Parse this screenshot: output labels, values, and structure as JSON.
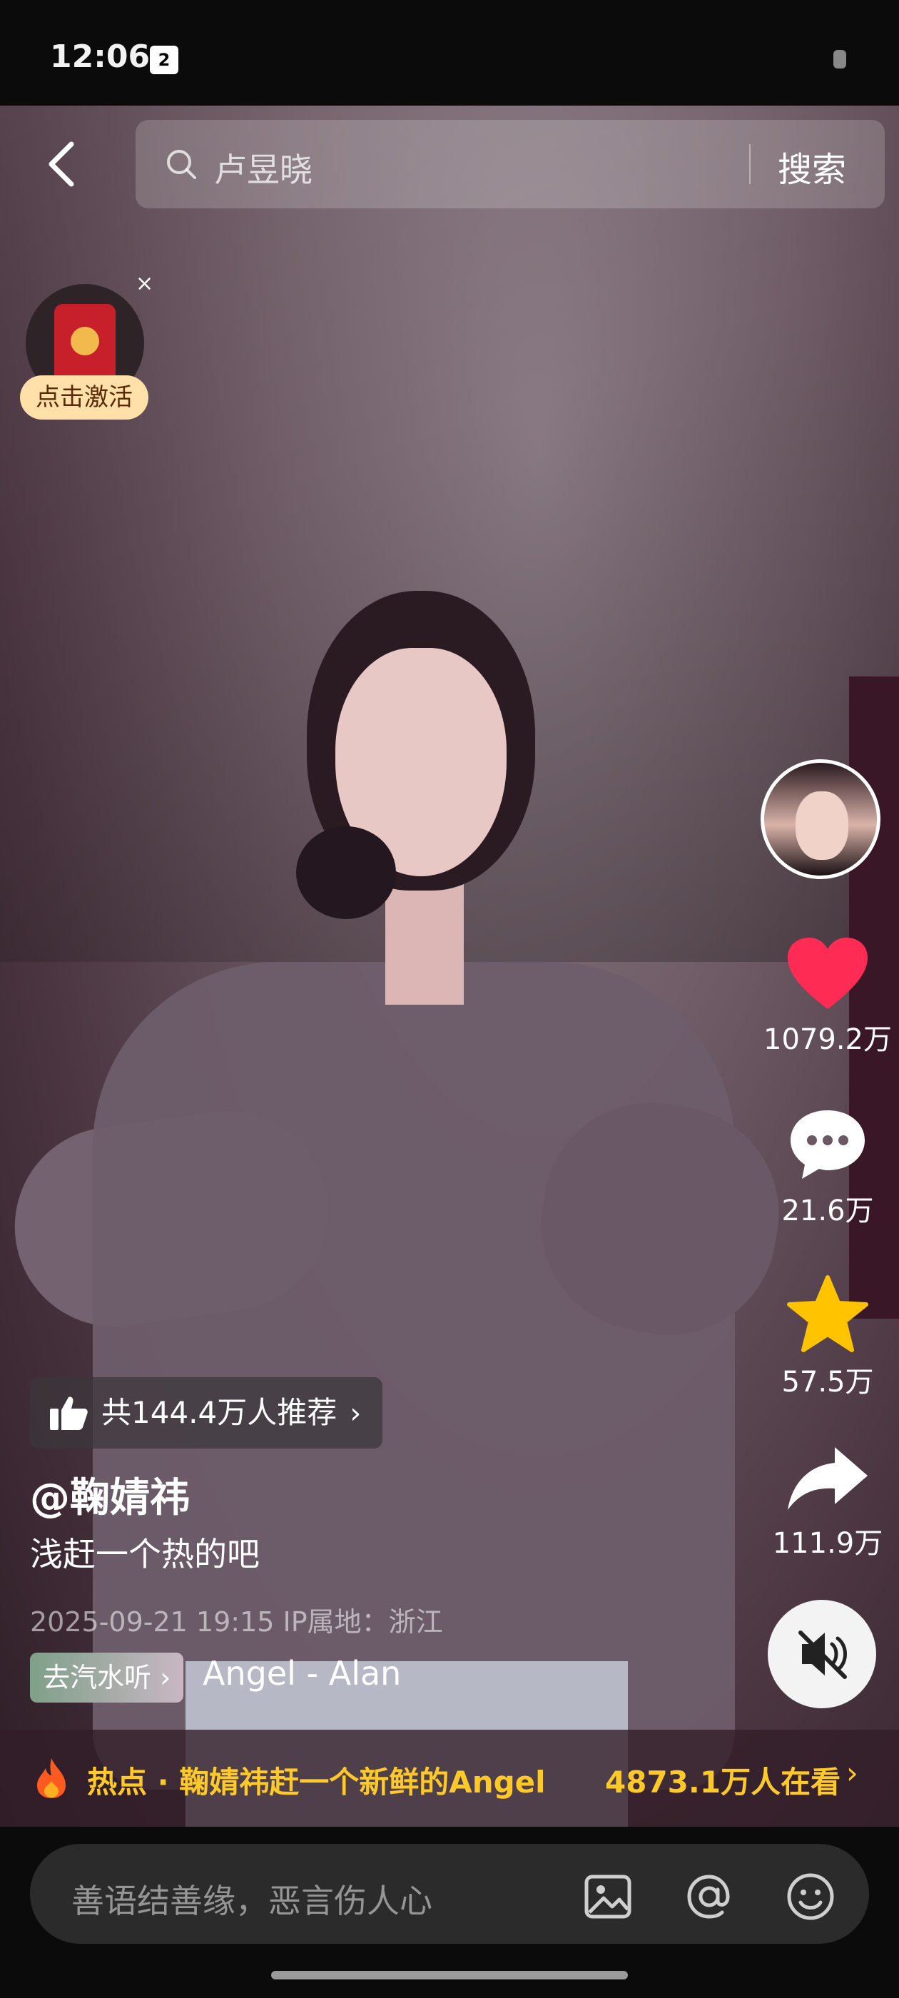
{
  "status_bar": {
    "time": "12:06",
    "calendar_day": "2"
  },
  "search": {
    "query": "卢昱晓",
    "button_label": "搜索"
  },
  "promo": {
    "label": "点击激活",
    "close_symbol": "×"
  },
  "actions": {
    "like_count": "1079.2万",
    "comment_count": "21.6万",
    "favorite_count": "57.5万",
    "share_count": "111.9万"
  },
  "post": {
    "recommend_text": "共144.4万人推荐",
    "recommend_chevron": "›",
    "author": "@鞠婧祎",
    "caption": "浅赶一个热的吧",
    "meta": "2025-09-21 19:15  IP属地：浙江",
    "music_tag": "去汽水听 ›",
    "music_name": "Angel - Alan"
  },
  "hot": {
    "label": "热点 · 鞠婧祎赶一个新鲜的Angel",
    "viewers": "4873.1万人在看",
    "chevron": "›"
  },
  "comment": {
    "placeholder": "善语结善缘，恶言伤人心"
  },
  "colors": {
    "accent_yellow": "#ffc928",
    "like_red": "#fe2c55",
    "star_gold": "#ffc300"
  }
}
